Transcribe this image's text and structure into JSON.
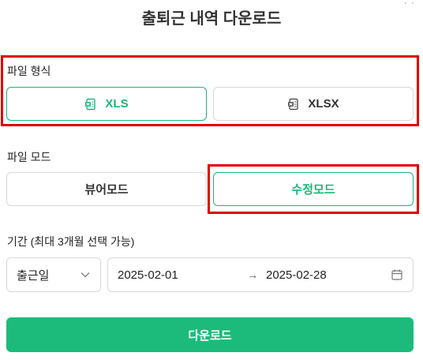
{
  "dialog": {
    "title": "출퇴근 내역 다운로드"
  },
  "file_format": {
    "label": "파일 형식",
    "options": [
      {
        "label": "XLS",
        "icon": "excel-file-icon",
        "selected": true
      },
      {
        "label": "XLSX",
        "icon": "excel-file-icon",
        "selected": false
      }
    ]
  },
  "file_mode": {
    "label": "파일 모드",
    "options": [
      {
        "label": "뷰어모드",
        "selected": false
      },
      {
        "label": "수정모드",
        "selected": true
      }
    ]
  },
  "period": {
    "label": "기간 (최대 3개월 선택 가능)",
    "type_select": {
      "value": "출근일",
      "icon": "chevron-down-icon"
    },
    "start_date": "2025-02-01",
    "arrow": "→",
    "end_date": "2025-02-28",
    "calendar_icon": "calendar-icon"
  },
  "download_button": {
    "label": "다운로드"
  },
  "colors": {
    "accent": "#1cb67a",
    "highlight": "#e10000"
  }
}
